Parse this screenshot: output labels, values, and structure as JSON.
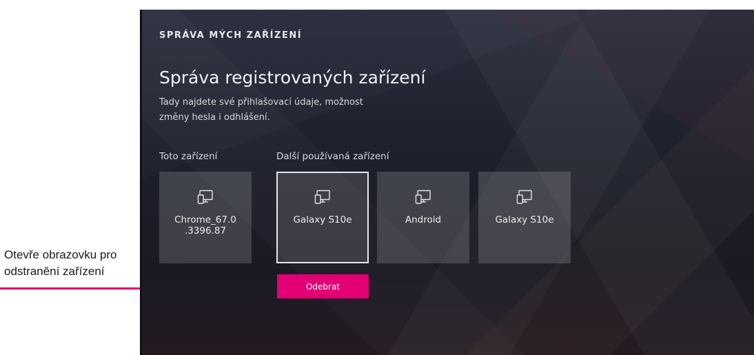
{
  "annotation": {
    "text": "Otevře obrazovku pro\nodstranění zařízení",
    "color": "#e20074"
  },
  "screen": {
    "section_title": "SPRÁVA MÝCH ZAŘÍZENÍ",
    "page_title": "Správa registrovaných zařízení",
    "description": "Tady najdete své přihlašovací údaje, možnost\nzměny hesla i odhlášení.",
    "this_device_label": "Toto zařízení",
    "other_devices_label": "Další používaná zařízení",
    "devices": [
      {
        "name": "Chrome_67.0\n.3396.87",
        "icon": "devices-icon",
        "group": "this",
        "selected": false
      },
      {
        "name": "Galaxy S10e",
        "icon": "devices-icon",
        "group": "other",
        "selected": true
      },
      {
        "name": "Android",
        "icon": "devices-icon",
        "group": "other",
        "selected": false
      },
      {
        "name": "Galaxy S10e",
        "icon": "devices-icon",
        "group": "other",
        "selected": false
      }
    ],
    "remove_button_label": "Odebrat",
    "accent_color": "#e20074"
  }
}
